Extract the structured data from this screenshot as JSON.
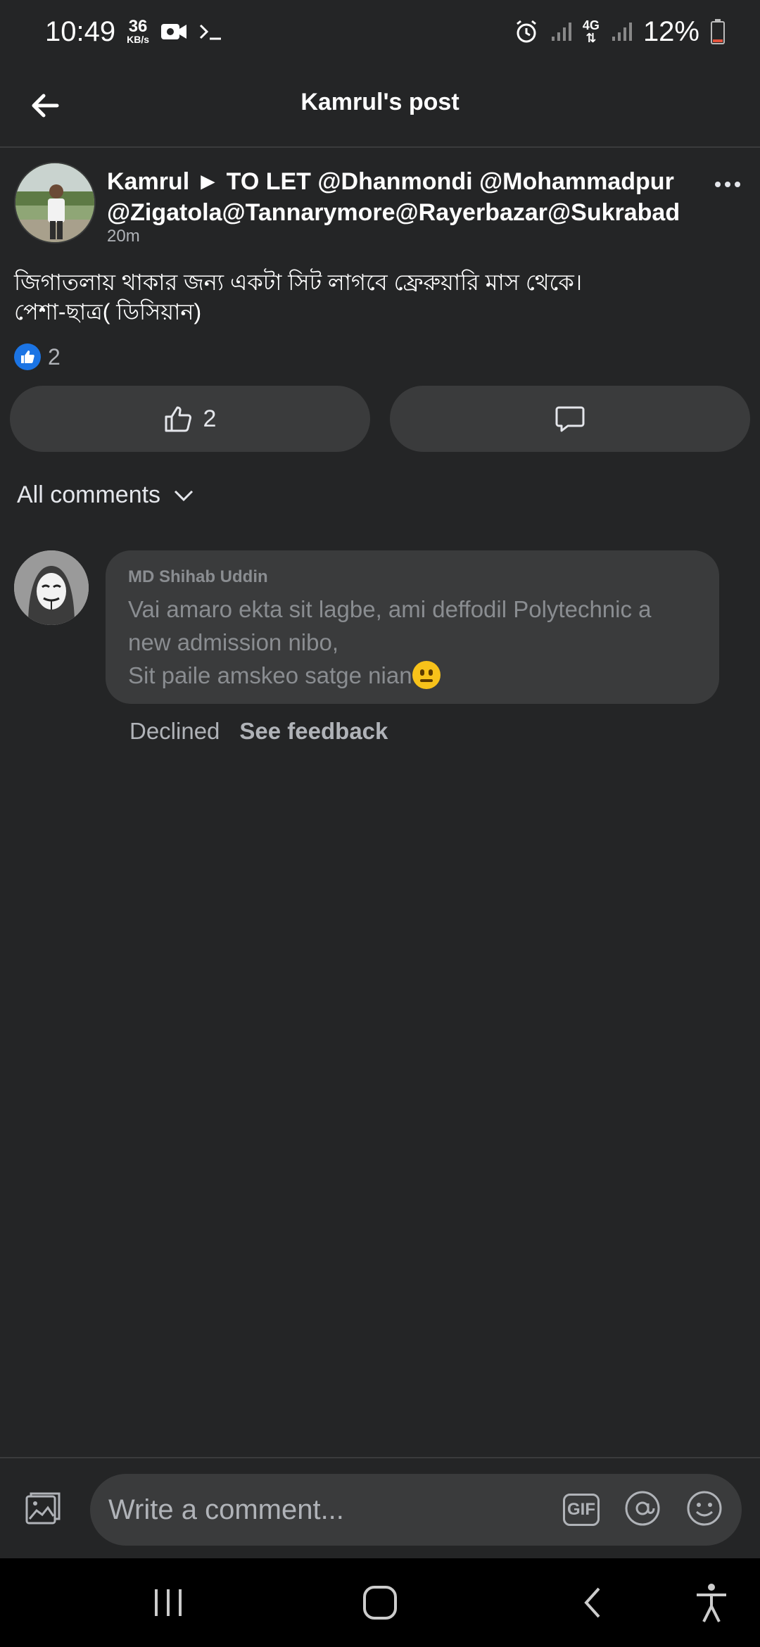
{
  "status_bar": {
    "time": "10:49",
    "speed_value": "36",
    "speed_unit": "KB/s",
    "network": "4G",
    "battery": "12%"
  },
  "header": {
    "title": "Kamrul's post"
  },
  "post": {
    "author_line": "Kamrul ► TO LET @Dhanmondi @Mohammadpur @Zigatola@Tannarymore@Rayerbazar@Sukrabad",
    "time": "20m",
    "text": "জিগাতলায় থাকার জন্য একটা সিট লাগবে ফ্রেরুয়ারি মাস থেকে।\nপেশা-ছাত্র( ডিসিয়ান)",
    "reaction_count": "2",
    "like_button_count": "2"
  },
  "comments_section": {
    "filter_label": "All comments"
  },
  "comment": {
    "author": "MD Shihab Uddin",
    "text": "Vai amaro ekta sit lagbe,  ami deffodil Polytechnic a new admission nibo,\nSit paile amskeo satge nian",
    "status": "Declined",
    "feedback_link": "See feedback"
  },
  "composer": {
    "placeholder": "Write a comment...",
    "gif_label": "GIF"
  },
  "colors": {
    "background": "#242526",
    "surface": "#3a3b3c",
    "like_blue": "#1b74e4",
    "battery_low": "#e5533d"
  }
}
